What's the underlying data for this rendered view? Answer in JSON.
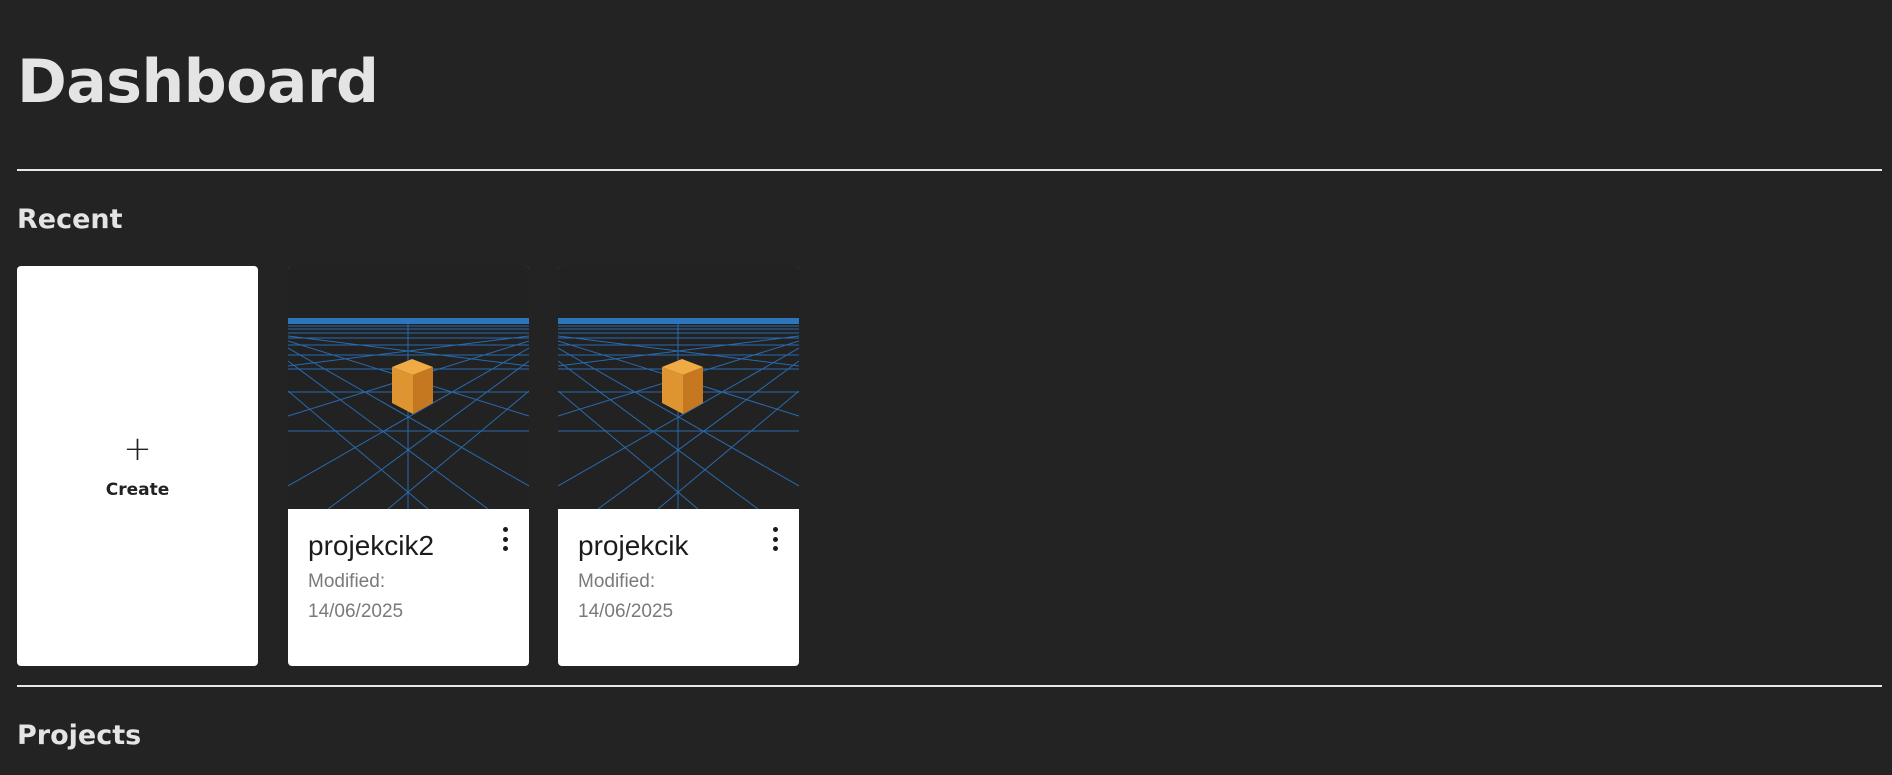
{
  "header": {
    "title": "Dashboard"
  },
  "recent": {
    "heading": "Recent",
    "create": {
      "icon": "+",
      "label": "Create"
    },
    "projects": [
      {
        "name": "projekcik2",
        "modified_label": "Modified:",
        "modified_date": "14/06/2025",
        "thumbnail_icon": "cube-scene-thumbnail"
      },
      {
        "name": "projekcik",
        "modified_label": "Modified:",
        "modified_date": "14/06/2025",
        "thumbnail_icon": "cube-scene-thumbnail"
      }
    ]
  },
  "projects_section": {
    "heading": "Projects"
  },
  "colors": {
    "background": "#232323",
    "card": "#ffffff",
    "grid": "#2d7fd6",
    "cube": "#e0962f"
  }
}
